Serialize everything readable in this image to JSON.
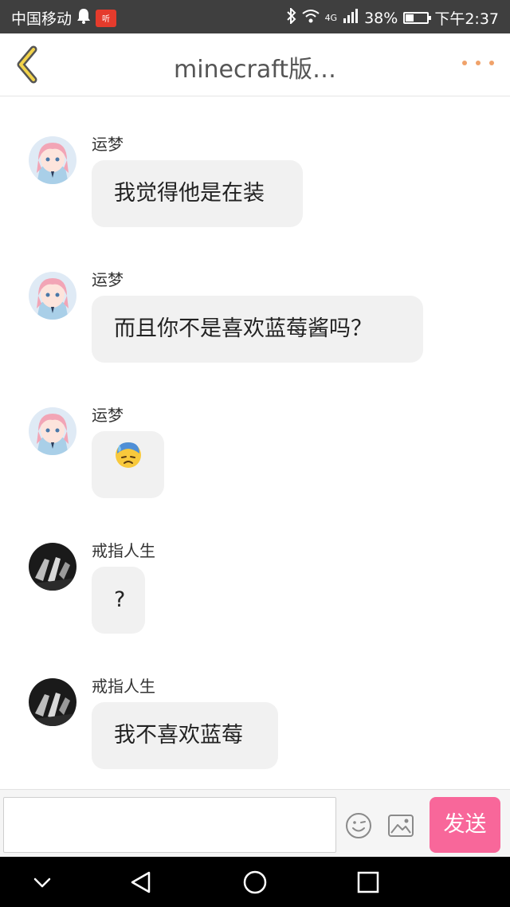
{
  "status_bar": {
    "carrier": "中国移动",
    "network": "4G",
    "battery": "38%",
    "battery_level": 0.38,
    "time": "下午2:37",
    "app_icon_label": "听"
  },
  "header": {
    "title": "minecraft版…",
    "back_icon": "chevron-left-icon",
    "more_icon": "more-dots-icon",
    "accent_color": "#f0a26a"
  },
  "messages": [
    {
      "sender": "运梦",
      "text": "我觉得他是在装",
      "avatar": "anime-girl-avatar"
    },
    {
      "sender": "运梦",
      "text": "而且你不是喜欢蓝莓酱吗？",
      "avatar": "anime-girl-avatar"
    },
    {
      "sender": "运梦",
      "emoji": "anxious-sweat-face-emoji",
      "avatar": "anime-girl-avatar"
    },
    {
      "sender": "戒指人生",
      "text": "?",
      "avatar": "dark-photo-avatar"
    },
    {
      "sender": "戒指人生",
      "text": "我不喜欢蓝莓",
      "avatar": "dark-photo-avatar"
    }
  ],
  "input_bar": {
    "placeholder": "",
    "send_label": "发送",
    "send_color": "#f8679a",
    "emoji_icon": "smiley-icon",
    "image_icon": "image-icon"
  },
  "nav_bar": {
    "icons": [
      "chevron-down-icon",
      "back-triangle-icon",
      "home-circle-icon",
      "recents-square-icon"
    ]
  }
}
